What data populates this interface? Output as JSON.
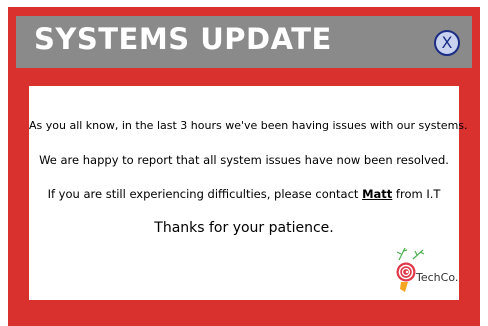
{
  "dialog": {
    "title": "SYSTEMS UPDATE",
    "close_label": "X"
  },
  "message": {
    "line1": "As you all know, in the last 3 hours we've been having issues with our systems.",
    "line2": "We are happy to report that all system issues have now been resolved.",
    "line3_prefix": "If you are still experiencing difficulties, please contact ",
    "line3_contact": "Matt",
    "line3_suffix": " from I.T",
    "line4": "Thanks for your patience."
  },
  "brand": {
    "name": "TechCo.",
    "logo_icon": "rose-icon"
  },
  "colors": {
    "frame": "#d8312e",
    "titlebar": "#8a8a8a",
    "close_button": "#c9d3f0",
    "close_border": "#1c2d86"
  }
}
